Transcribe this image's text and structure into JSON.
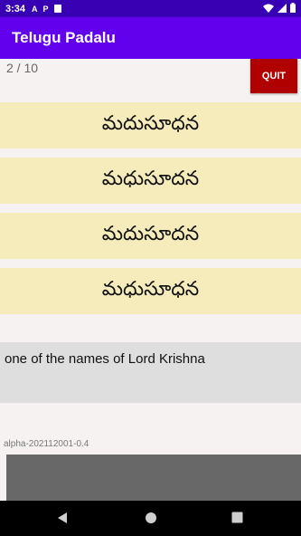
{
  "status_bar": {
    "time": "3:34",
    "icons": [
      "a-icon",
      "p-icon",
      "sd-card-icon",
      "wifi-icon",
      "signal-icon",
      "battery-icon"
    ],
    "a_glyph": "A",
    "p_glyph": "P"
  },
  "app_bar": {
    "title": "Telugu Padalu",
    "color": "#6200ee"
  },
  "quiz": {
    "progress": "2 / 10",
    "quit_label": "QUIT",
    "options": [
      "మదుసూధన",
      "మధుసూదన",
      "మదుసూదన",
      "మధుసూధన"
    ],
    "meaning": "one of the names of Lord Krishna"
  },
  "footer": {
    "version": "alpha-202112001-0.4"
  },
  "nav_bar": {
    "buttons": [
      "back-icon",
      "home-icon",
      "recents-icon"
    ]
  }
}
